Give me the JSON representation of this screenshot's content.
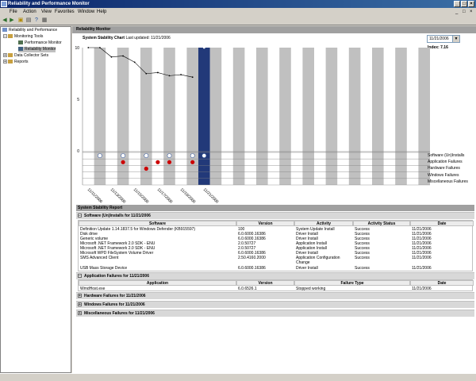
{
  "window": {
    "title": "Reliability and Performance Monitor"
  },
  "menu": [
    "File",
    "Action",
    "View",
    "Favorites",
    "Window",
    "Help"
  ],
  "tree": {
    "root": "Reliability and Performance",
    "monitoring_tools": "Monitoring Tools",
    "performance_monitor": "Performance Monitor",
    "reliability_monitor": "Reliability Monitor",
    "data_collector_sets": "Data Collector Sets",
    "reports": "Reports"
  },
  "main": {
    "header": "Reliability Monitor",
    "chart_title": "System Stability Chart",
    "last_updated": "Last updated: 11/21/2006",
    "selected_date": "11/21/2006",
    "index_label": "Index: 7.16"
  },
  "chart_data": {
    "type": "line",
    "title": "System Stability Chart",
    "ylim": [
      0,
      10
    ],
    "yticks": [
      "10",
      "5",
      "0"
    ],
    "x_labels": [
      "11/11/2006",
      "11/13/2006",
      "11/15/2006",
      "11/17/2006",
      "11/19/2006",
      "11/21/2006"
    ],
    "x": [
      0,
      1,
      2,
      3,
      4,
      5,
      6,
      7,
      8,
      9,
      10
    ],
    "values": [
      10,
      10,
      9.1,
      9.2,
      8.6,
      7.5,
      7.6,
      7.3,
      7.4,
      7.16
    ],
    "selected_index": 10,
    "category_rows": [
      "Software (Un)Installs",
      "Application Failures",
      "Hardware Failures",
      "Windows Failures",
      "Miscellaneous Failures"
    ],
    "software_installs_cols": [
      1,
      3,
      5,
      7,
      9,
      10
    ],
    "application_failure_cols": [
      3,
      6,
      7,
      9
    ],
    "hardware_failure_cols": [
      5
    ],
    "colors": {
      "bar": "#c0c0c0",
      "selected": "#0a246a",
      "failure": "#cc0000",
      "line": "#000000"
    }
  },
  "report": {
    "title": "System Stability Report",
    "software": {
      "header": "Software (Un)Installs for 11/21/2006",
      "columns": [
        "Software",
        "Version",
        "Activity",
        "Activity Status",
        "Date"
      ],
      "rows": [
        [
          "Definition Update 1.14.1837.5 for Windows Defender (KB915597)",
          "100",
          "System Update Install",
          "Success",
          "11/21/2006"
        ],
        [
          "Disk drive",
          "6.0.6000.16386",
          "Driver Install",
          "Success",
          "11/21/2006"
        ],
        [
          "Generic volume",
          "6.0.6000.16386",
          "Driver Install",
          "Success",
          "11/21/2006"
        ],
        [
          "Microsoft .NET Framework 2.0 SDK - ENU",
          "2.0.50727",
          "Application Install",
          "Success",
          "11/21/2006"
        ],
        [
          "Microsoft .NET Framework 2.0 SDK - ENU",
          "2.0.50727",
          "Application Install",
          "Success",
          "11/21/2006"
        ],
        [
          "Microsoft WPD FileSystem Volume Driver",
          "6.0.6000.16386",
          "Driver Install",
          "Success",
          "11/21/2006"
        ],
        [
          "SMS Advanced Client",
          "2.50.4160.2000",
          "Application Configuration Change",
          "Success",
          "11/21/2006"
        ],
        [
          "USB Mass Storage Device",
          "6.0.6000.16386",
          "Driver Install",
          "Success",
          "11/21/2006"
        ]
      ]
    },
    "appfail": {
      "header": "Application Failures for 11/21/2006",
      "columns": [
        "Application",
        "Version",
        "Failure Type",
        "Date"
      ],
      "rows": [
        [
          "WmdHost.exe",
          "6.0.6526.1",
          "Stopped working",
          "11/21/2006"
        ]
      ]
    },
    "hardware": {
      "header": "Hardware Failures for 11/21/2006"
    },
    "windows": {
      "header": "Windows Failures for 11/21/2006"
    },
    "misc": {
      "header": "Miscellaneous Failures for 11/21/2006"
    }
  }
}
